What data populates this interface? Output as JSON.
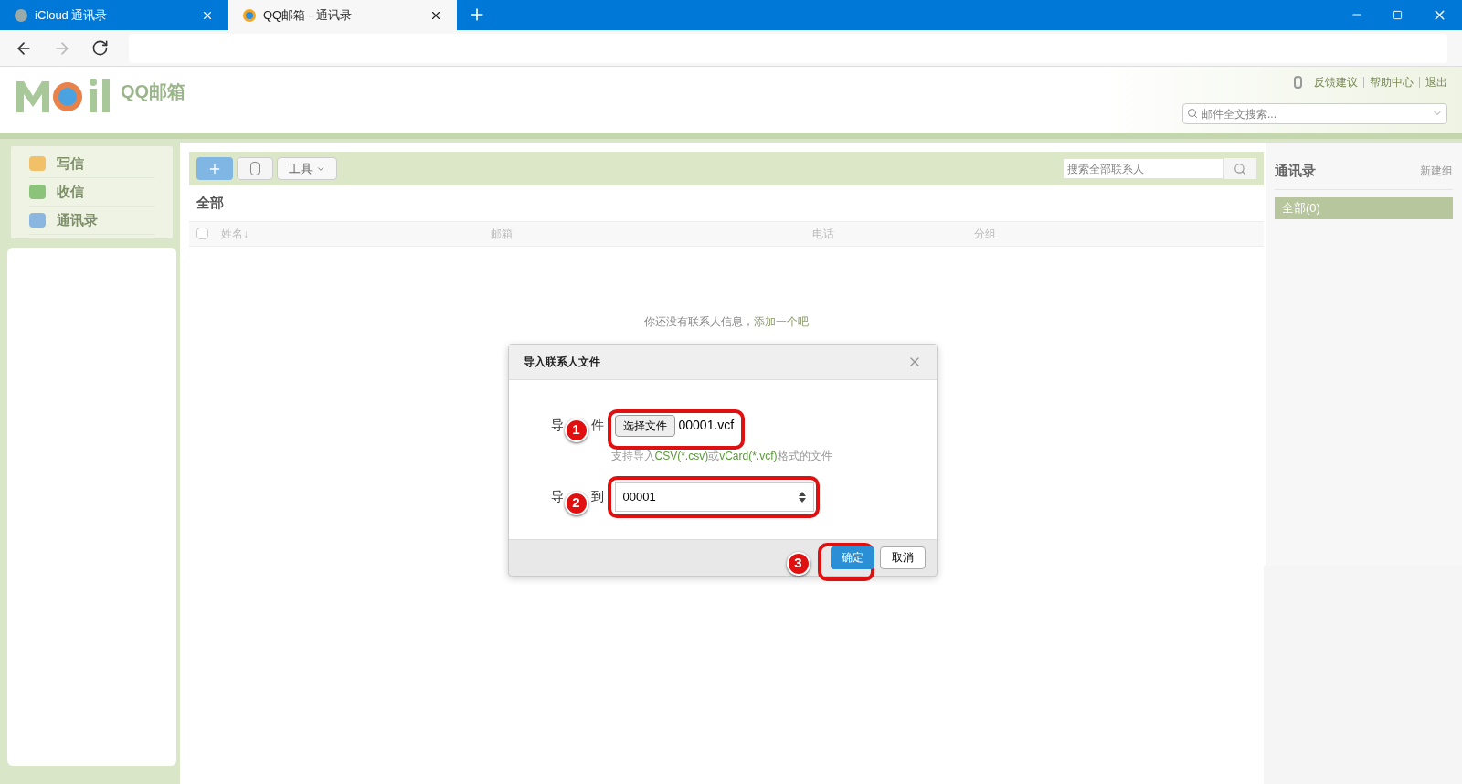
{
  "browser": {
    "tabs": [
      {
        "title": "iCloud 通讯录",
        "selected": false
      },
      {
        "title": "QQ邮箱 - 通讯录",
        "selected": true
      }
    ]
  },
  "header": {
    "logo_text": "QQ邮箱",
    "links": [
      "反馈建议",
      "帮助中心",
      "退出"
    ],
    "search": {
      "placeholder": "邮件全文搜索..."
    }
  },
  "sidebar": {
    "items": [
      {
        "label": "写信",
        "kind": "compose"
      },
      {
        "label": "收信",
        "kind": "inbox"
      },
      {
        "label": "通讯录",
        "kind": "contacts"
      }
    ]
  },
  "toolbar": {
    "tools_label": "工具",
    "search": {
      "placeholder": "搜索全部联系人"
    }
  },
  "list": {
    "title": "全部",
    "select_all": {
      "checked": false
    },
    "columns": [
      "姓名↓",
      "邮箱",
      "电话",
      "分组"
    ],
    "empty_text": "你还没有联系人信息，",
    "empty_link": "添加一个吧"
  },
  "groups": {
    "title": "通讯录",
    "new_group": "新建组",
    "items": [
      {
        "label": "全部(0)",
        "selected": true
      }
    ]
  },
  "dialog": {
    "title": "导入联系人文件",
    "file_label": [
      "导",
      "件"
    ],
    "choose_button": "选择文件",
    "file_name": "00001.vcf",
    "hint": [
      {
        "text": "支持导入",
        "kind": "plain"
      },
      {
        "text": "CSV(*.csv)",
        "kind": "format"
      },
      {
        "text": "或",
        "kind": "plain"
      },
      {
        "text": "vCard(*.vcf)",
        "kind": "format"
      },
      {
        "text": "格式的文件",
        "kind": "plain"
      }
    ],
    "target_label": [
      "导",
      "到"
    ],
    "target_value": "00001",
    "ok": "确定",
    "cancel": "取消"
  },
  "annotations": [
    "1",
    "2",
    "3"
  ]
}
